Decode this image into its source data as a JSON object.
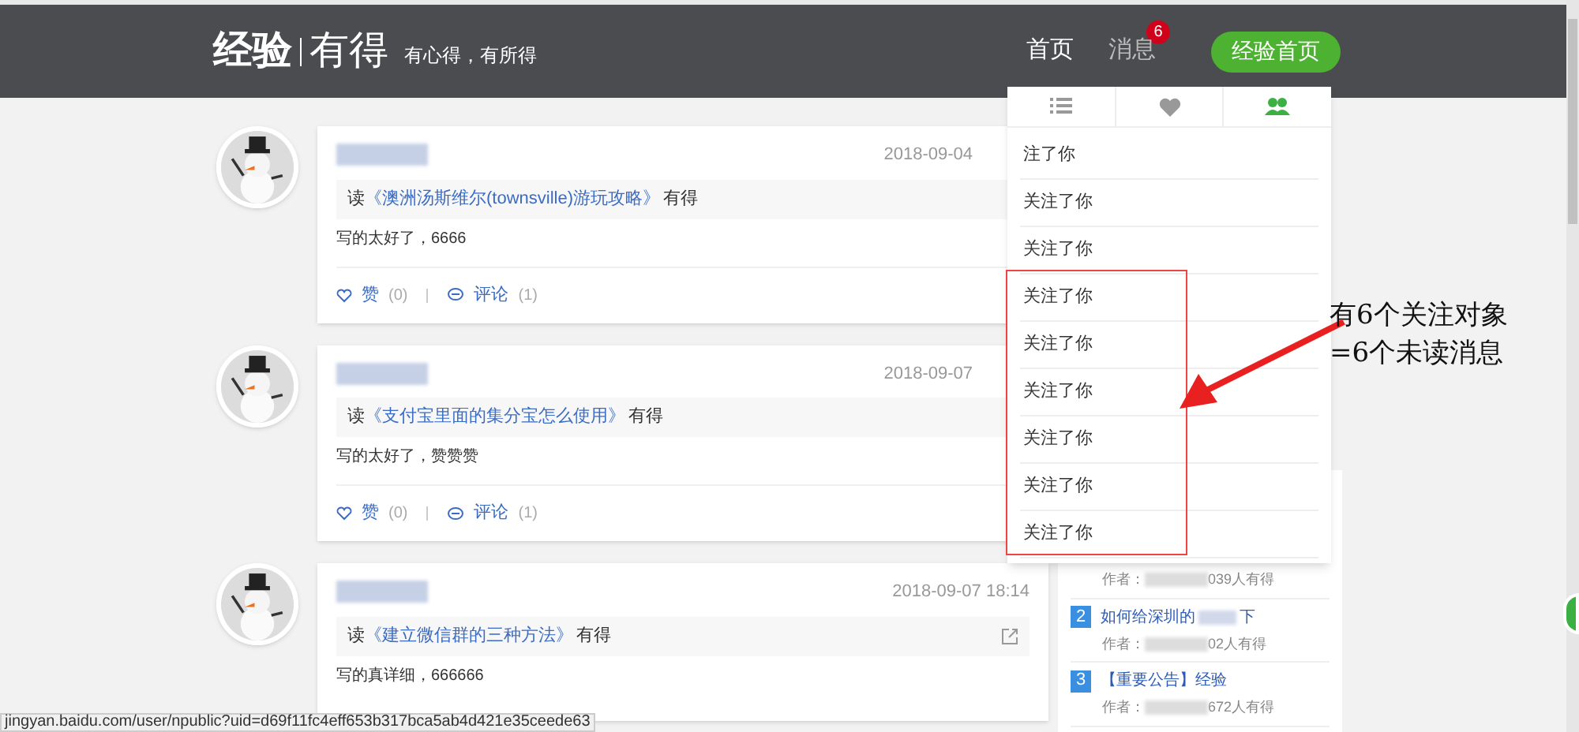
{
  "header": {
    "logo_main": "经验",
    "logo_sub": "有得",
    "slogan": "有心得，有所得",
    "nav": [
      {
        "label": "首页",
        "selected": true
      },
      {
        "label": "消息",
        "selected": false,
        "badge": "6"
      }
    ],
    "button": "经验首页"
  },
  "feed": [
    {
      "date": "2018-09-04",
      "prefix": "读",
      "article": "《澳洲汤斯维尔(townsville)游玩攻略》",
      "suffix": "有得",
      "comment": "写的太好了，6666",
      "like": "赞",
      "like_count": "(0)",
      "reply": "评论",
      "reply_count": "(1)",
      "share": false
    },
    {
      "date": "2018-09-07",
      "prefix": "读",
      "article": "《支付宝里面的集分宝怎么使用》",
      "suffix": "有得",
      "comment": "写的太好了，赞赞赞",
      "like": "赞",
      "like_count": "(0)",
      "reply": "评论",
      "reply_count": "(1)",
      "share": false
    },
    {
      "date": "2018-09-07 18:14",
      "prefix": "读",
      "article": "《建立微信群的三种方法》",
      "suffix": "有得",
      "comment": "写的真详细，666666",
      "share": true
    }
  ],
  "dropdown": {
    "tabs": [
      {
        "kind": "list",
        "selected": false
      },
      {
        "kind": "heart",
        "selected": false
      },
      {
        "kind": "people",
        "selected": true
      }
    ],
    "items": [
      {
        "text": "注了你"
      },
      {
        "text": "关注了你"
      },
      {
        "text": "关注了你"
      },
      {
        "text": "关注了你"
      },
      {
        "text": "关注了你"
      },
      {
        "text": "关注了你"
      },
      {
        "text": "关注了你"
      },
      {
        "text": "关注了你"
      },
      {
        "text": "关注了你"
      }
    ]
  },
  "sidebar": [
    {
      "author": "作者：",
      "count": "039人有得"
    },
    {
      "rank": "2",
      "title": "如何给深圳的",
      "title_end": "下",
      "author": "作者：",
      "count": "02人有得"
    },
    {
      "rank": "3",
      "title": "【重要公告】经验",
      "author": "作者：",
      "count": "672人有得"
    }
  ],
  "annotation": {
    "lines": [
      "有6个关注对象",
      "=6个未读消息"
    ]
  },
  "status_bar": "jingyan.baidu.com/user/npublic?uid=d69f11fc4eff653b317bca5ab4d421e35ceede63"
}
